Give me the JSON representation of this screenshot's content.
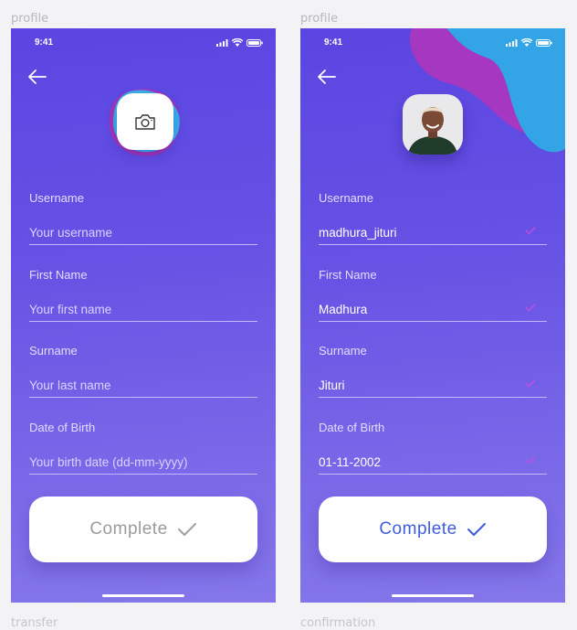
{
  "frames": [
    {
      "label": "profile",
      "status_time": "9:41",
      "fields": [
        {
          "label": "Username",
          "value": "",
          "placeholder": "Your username"
        },
        {
          "label": "First Name",
          "value": "",
          "placeholder": "Your first name"
        },
        {
          "label": "Surname",
          "value": "",
          "placeholder": "Your last name"
        },
        {
          "label": "Date of Birth",
          "value": "",
          "placeholder": "Your birth date (dd-mm-yyyy)"
        }
      ],
      "button": {
        "label": "Complete",
        "state": "disabled",
        "color": "#9a9a9f"
      }
    },
    {
      "label": "profile",
      "status_time": "9:41",
      "fields": [
        {
          "label": "Username",
          "value": "madhura_jituri",
          "placeholder": ""
        },
        {
          "label": "First Name",
          "value": "Madhura",
          "placeholder": ""
        },
        {
          "label": "Surname",
          "value": "Jituri",
          "placeholder": ""
        },
        {
          "label": "Date of Birth",
          "value": "01-11-2002",
          "placeholder": ""
        }
      ],
      "button": {
        "label": "Complete",
        "state": "enabled",
        "color": "#3d5be0"
      }
    }
  ],
  "bottom_labels": [
    "transfer",
    "confirmation"
  ],
  "icons": {
    "back": "arrow-left-icon",
    "camera": "camera-icon",
    "check": "checkmark-icon",
    "signal": "cellular-signal-icon",
    "wifi": "wifi-icon",
    "battery": "battery-icon"
  },
  "colors": {
    "gradient_top": "#5b45e2",
    "gradient_bottom": "#8476ea",
    "blob_blue": "#33a5e6",
    "blob_magenta": "#a237c2",
    "check_pink": "#c34fe0"
  }
}
